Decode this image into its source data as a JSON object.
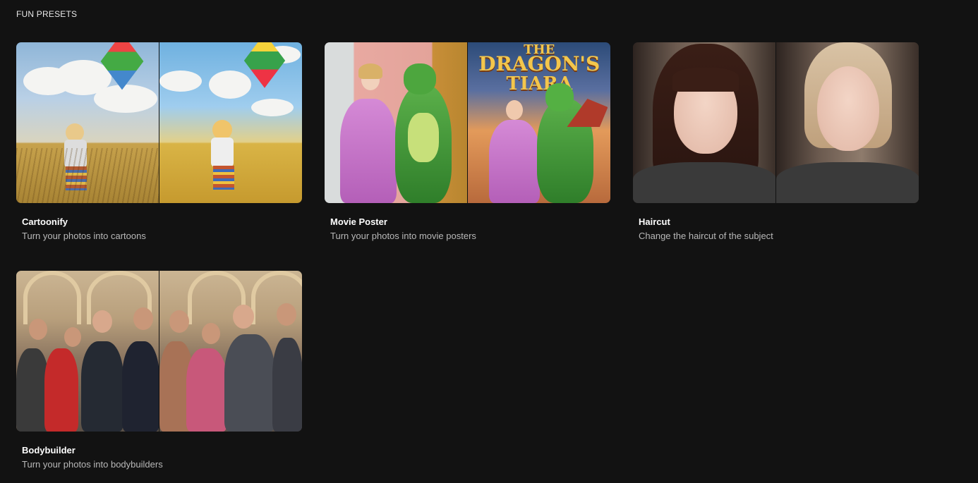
{
  "section": {
    "title": "FUN PRESETS"
  },
  "presets": [
    {
      "title": "Cartoonify",
      "description": "Turn your photos into cartoons"
    },
    {
      "title": "Movie Poster",
      "description": "Turn your photos into movie posters",
      "poster_title_line1": "THE",
      "poster_title_line2": "DRAGON'S",
      "poster_title_line3": "TIARA"
    },
    {
      "title": "Haircut",
      "description": "Change the haircut of the subject"
    },
    {
      "title": "Bodybuilder",
      "description": "Turn your photos into bodybuilders"
    }
  ]
}
